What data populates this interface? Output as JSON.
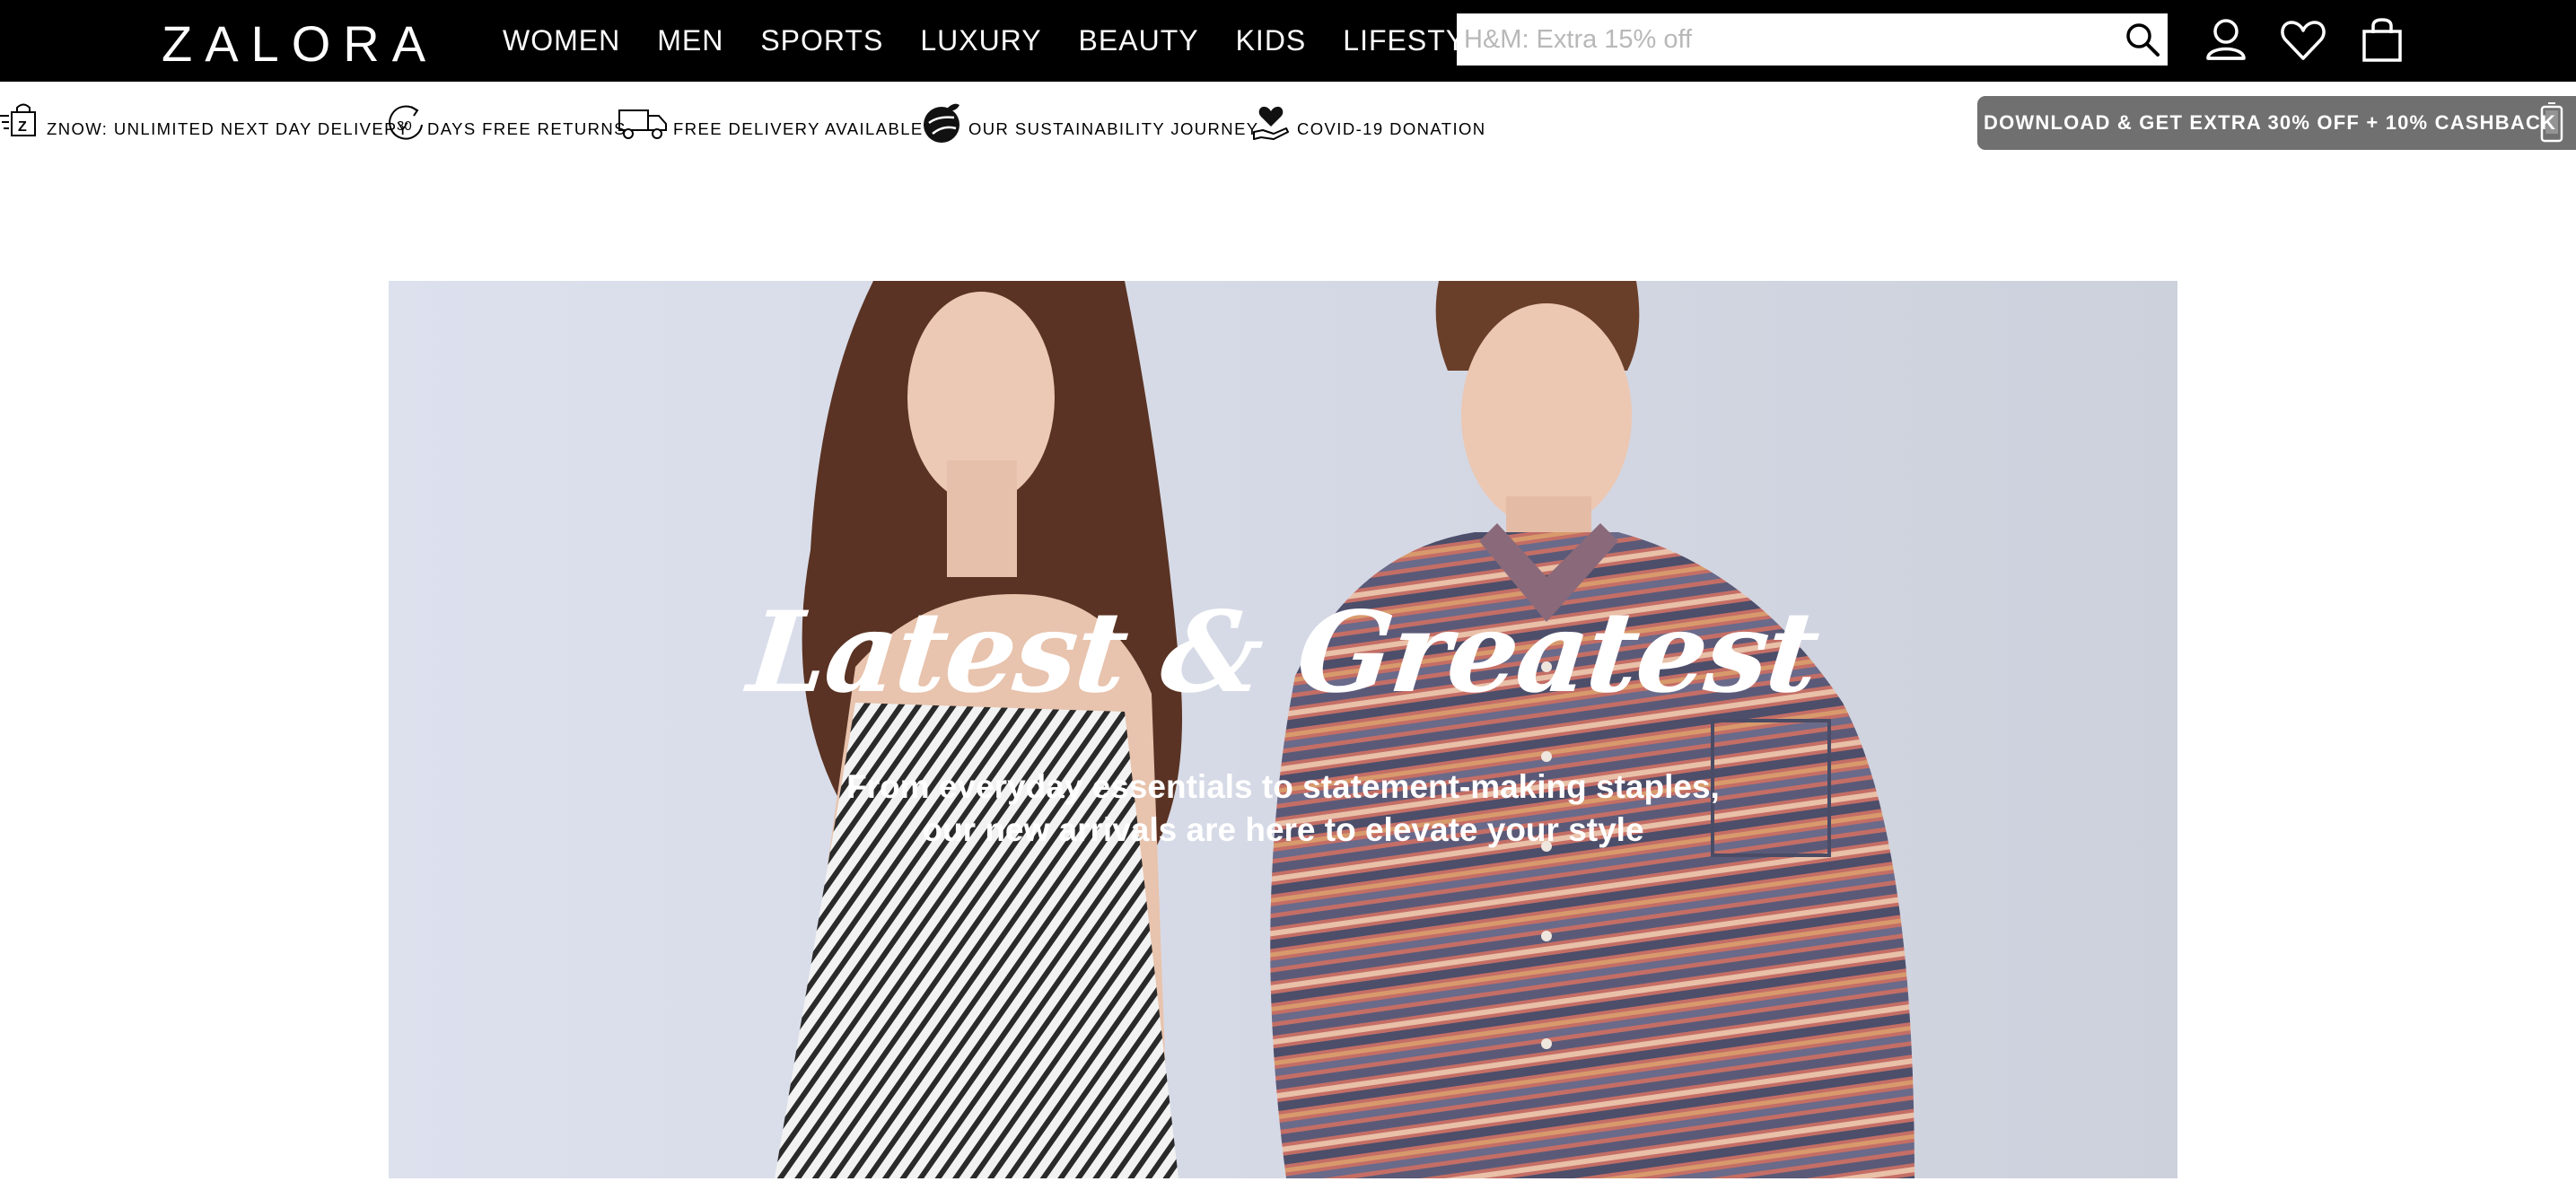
{
  "header": {
    "logo": "ZALORA",
    "nav": [
      "WOMEN",
      "MEN",
      "SPORTS",
      "LUXURY",
      "BEAUTY",
      "KIDS",
      "LIFESTYLE"
    ],
    "search_placeholder": "H&M: Extra 15% off",
    "icons": [
      "search-icon",
      "account-icon",
      "wishlist-heart-icon",
      "shopping-bag-icon"
    ]
  },
  "usp": {
    "znow": "ZNOW: UNLIMITED NEXT DAY DELIVERY",
    "returns_badge": "30",
    "returns": "DAYS FREE RETURNS",
    "delivery": "FREE DELIVERY AVAILABLE*",
    "sustainability": "OUR SUSTAINABILITY JOURNEY",
    "donation": "COVID-19 DONATION"
  },
  "download_banner": "DOWNLOAD & GET EXTRA 30% OFF + 10% CASHBACK",
  "hero": {
    "title": "Latest & Greatest",
    "subtitle_line1": "From everyday essentials to statement-making staples,",
    "subtitle_line2": "our new arrivals are here to elevate your style"
  },
  "colors": {
    "header_bg": "#000000",
    "download_bg": "#707070",
    "hero_bg": "#d7dbe7"
  }
}
